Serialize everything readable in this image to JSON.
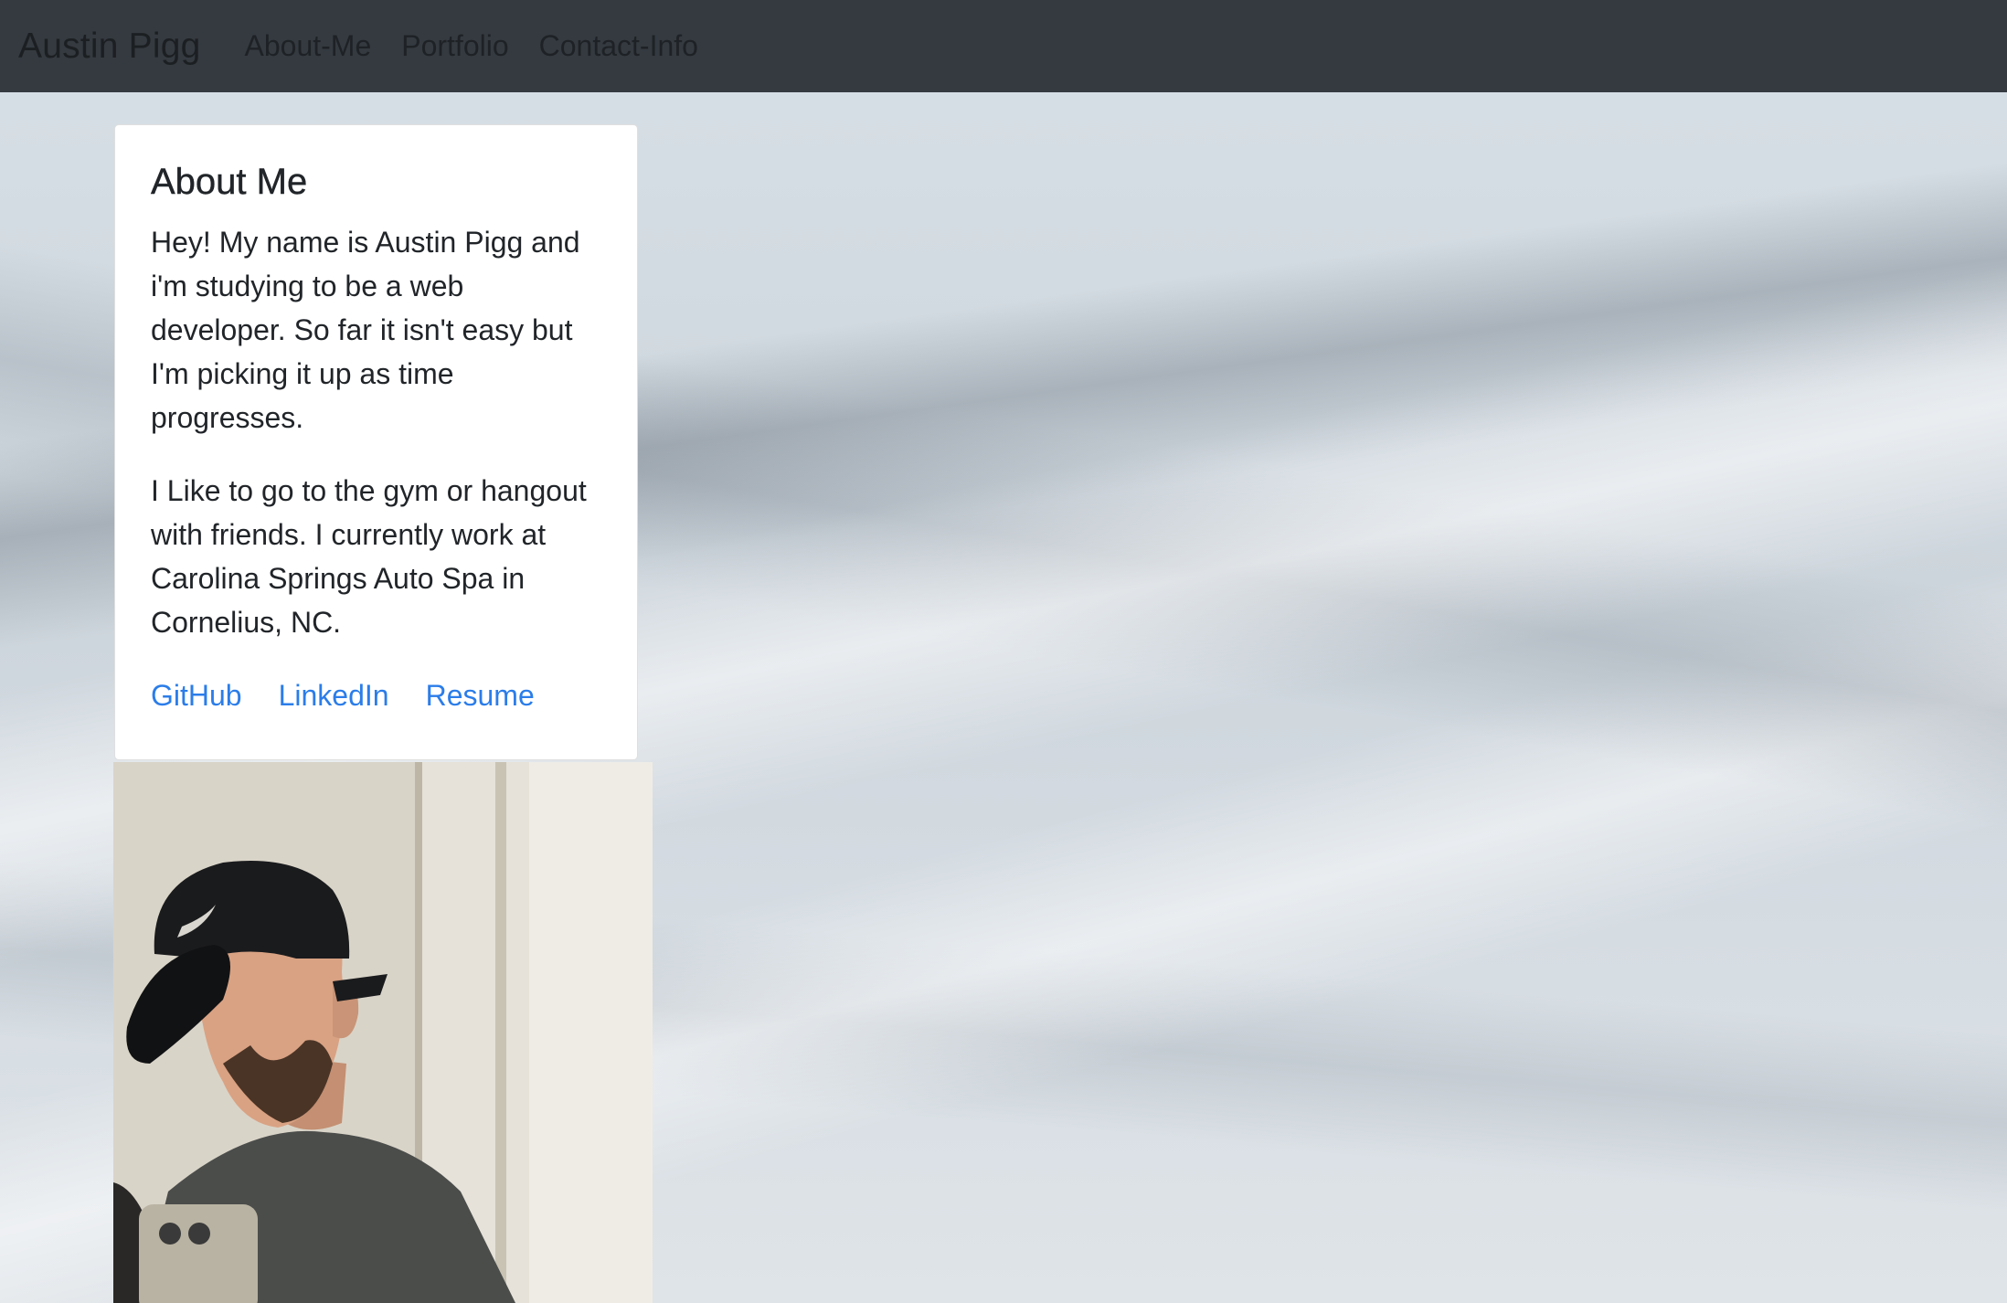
{
  "navbar": {
    "brand": "Austin Pigg",
    "links": [
      "About-Me",
      "Portfolio",
      "Contact-Info"
    ]
  },
  "card": {
    "title": "About Me",
    "paragraphs": [
      "Hey! My name is Austin Pigg and i'm studying to be a web developer. So far it isn't easy but I'm picking it up as time progresses.",
      "I Like to go to the gym or hangout with friends. I currently work at Carolina Springs Auto Spa in Cornelius, NC."
    ],
    "links": [
      "GitHub",
      "LinkedIn",
      "Resume"
    ]
  },
  "colors": {
    "navbar_bg": "#343a40",
    "link": "#2b7de9",
    "text": "#212529"
  }
}
